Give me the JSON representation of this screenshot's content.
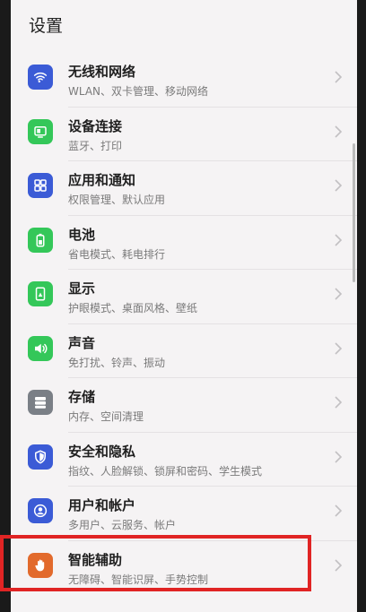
{
  "header": {
    "title": "设置"
  },
  "colors": {
    "blue": "#3b5bd6",
    "green": "#34c759",
    "gray": "#7a7f86",
    "orange": "#e26a2c",
    "highlight": "#e02424"
  },
  "items": [
    {
      "title": "无线和网络",
      "subtitle": "WLAN、双卡管理、移动网络",
      "icon": "wifi-icon",
      "color": "#3b5bd6"
    },
    {
      "title": "设备连接",
      "subtitle": "蓝牙、打印",
      "icon": "device-link-icon",
      "color": "#34c759"
    },
    {
      "title": "应用和通知",
      "subtitle": "权限管理、默认应用",
      "icon": "apps-grid-icon",
      "color": "#3b5bd6"
    },
    {
      "title": "电池",
      "subtitle": "省电模式、耗电排行",
      "icon": "battery-icon",
      "color": "#34c759"
    },
    {
      "title": "显示",
      "subtitle": "护眼模式、桌面风格、壁纸",
      "icon": "display-icon",
      "color": "#34c759"
    },
    {
      "title": "声音",
      "subtitle": "免打扰、铃声、振动",
      "icon": "speaker-icon",
      "color": "#34c759"
    },
    {
      "title": "存储",
      "subtitle": "内存、空间清理",
      "icon": "storage-icon",
      "color": "#7a7f86"
    },
    {
      "title": "安全和隐私",
      "subtitle": "指纹、人脸解锁、锁屏和密码、学生模式",
      "icon": "shield-icon",
      "color": "#3b5bd6"
    },
    {
      "title": "用户和帐户",
      "subtitle": "多用户、云服务、帐户",
      "icon": "user-icon",
      "color": "#3b5bd6"
    },
    {
      "title": "智能辅助",
      "subtitle": "无障碍、智能识屏、手势控制",
      "icon": "hand-icon",
      "color": "#e26a2c"
    }
  ]
}
